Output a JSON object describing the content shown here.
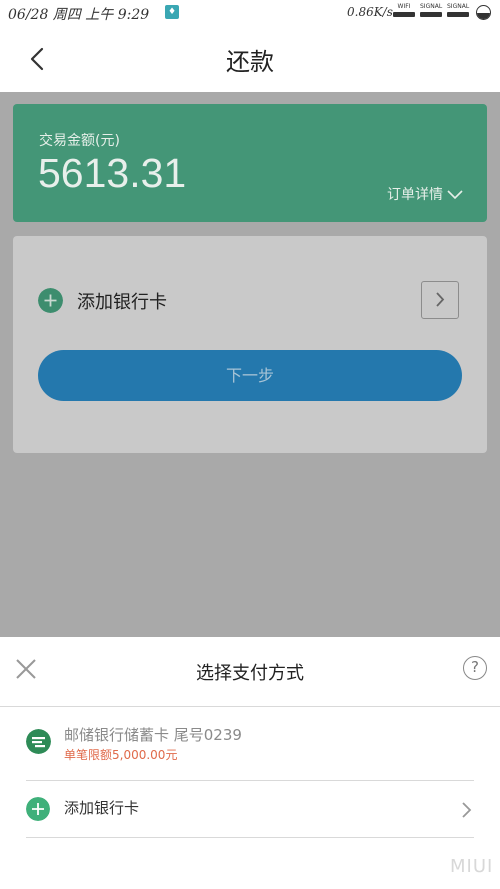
{
  "status_bar": {
    "time": "06/28 周四 上午 9:29",
    "speed": "0.86K/s",
    "wifi_label": "WIFI",
    "signal1_label": "SIGNAL",
    "signal2_label": "SIGNAL"
  },
  "nav": {
    "title": "还款",
    "back_icon": "back-arrow-icon"
  },
  "amount_card": {
    "label": "交易金额(元)",
    "value": "5613.31",
    "detail_label": "订单详情",
    "color": "#449677"
  },
  "bank_panel": {
    "add_label": "添加银行卡",
    "next_label": "下一步",
    "button_color": "#2478ad"
  },
  "sheet": {
    "title": "选择支付方式",
    "close_icon": "close-icon",
    "help_icon": "help-icon",
    "help_text": "?",
    "card": {
      "name": "邮储银行储蓄卡 尾号0239",
      "limit": "单笔限额5,000.00元",
      "icon": "postal-bank-logo-icon",
      "limit_color": "#e06a4a"
    },
    "add_card": {
      "label": "添加银行卡",
      "icon": "plus-circle-icon"
    }
  },
  "watermark": "MIUI"
}
